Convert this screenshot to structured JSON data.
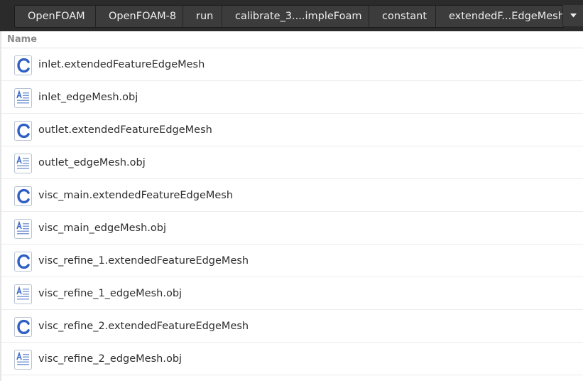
{
  "pathbar": {
    "crumbs": [
      "OpenFOAM",
      "OpenFOAM-8",
      "run",
      "calibrate_3....impleFoam",
      "constant",
      "extendedF...EdgeMesh"
    ]
  },
  "list": {
    "header_name": "Name",
    "files": [
      {
        "name": "inlet.extendedFeatureEdgeMesh",
        "icon": "c-source-file-icon"
      },
      {
        "name": "inlet_edgeMesh.obj",
        "icon": "text-file-icon"
      },
      {
        "name": "outlet.extendedFeatureEdgeMesh",
        "icon": "c-source-file-icon"
      },
      {
        "name": "outlet_edgeMesh.obj",
        "icon": "text-file-icon"
      },
      {
        "name": "visc_main.extendedFeatureEdgeMesh",
        "icon": "c-source-file-icon"
      },
      {
        "name": "visc_main_edgeMesh.obj",
        "icon": "text-file-icon"
      },
      {
        "name": "visc_refine_1.extendedFeatureEdgeMesh",
        "icon": "c-source-file-icon"
      },
      {
        "name": "visc_refine_1_edgeMesh.obj",
        "icon": "text-file-icon"
      },
      {
        "name": "visc_refine_2.extendedFeatureEdgeMesh",
        "icon": "c-source-file-icon"
      },
      {
        "name": "visc_refine_2_edgeMesh.obj",
        "icon": "text-file-icon"
      }
    ]
  }
}
